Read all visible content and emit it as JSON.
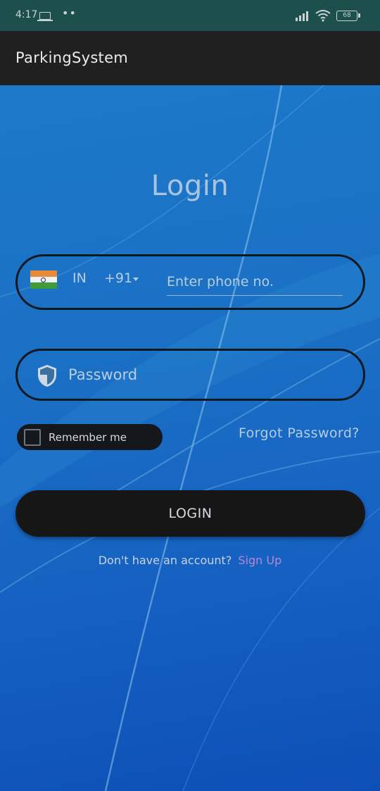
{
  "status_bar": {
    "time": "4:17",
    "battery": "68"
  },
  "app_bar": {
    "title": "ParkingSystem"
  },
  "login": {
    "heading": "Login",
    "phone": {
      "country": "IN",
      "dial_code": "+91",
      "placeholder": "Enter phone no."
    },
    "password": {
      "placeholder": "Password"
    },
    "remember_label": "Remember me",
    "forgot_label": "Forgot Password?",
    "button_label": "LOGIN",
    "signup_prompt": "Don't have an account?",
    "signup_link": "Sign Up"
  },
  "colors": {
    "accent": "#b489d1",
    "appbar": "#202020",
    "statusbar": "#1d4f4c"
  }
}
